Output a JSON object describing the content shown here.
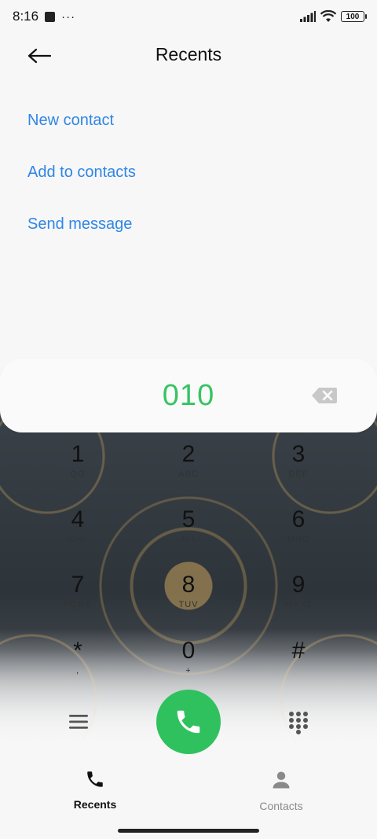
{
  "status_bar": {
    "time": "8:16",
    "more": "···",
    "battery": "100"
  },
  "header": {
    "title": "Recents",
    "back_icon": "arrow-left-icon"
  },
  "actions": [
    {
      "label": "New contact"
    },
    {
      "label": "Add to contacts"
    },
    {
      "label": "Send message"
    }
  ],
  "dialer": {
    "number": "010",
    "backspace_icon": "backspace-icon",
    "keys": [
      {
        "digit": "1",
        "letters": "QO"
      },
      {
        "digit": "2",
        "letters": "ABC"
      },
      {
        "digit": "3",
        "letters": "DEF"
      },
      {
        "digit": "4",
        "letters": "GHI"
      },
      {
        "digit": "5",
        "letters": "JKL"
      },
      {
        "digit": "6",
        "letters": "MNO"
      },
      {
        "digit": "7",
        "letters": "PQRS"
      },
      {
        "digit": "8",
        "letters": "TUV"
      },
      {
        "digit": "9",
        "letters": "WXYZ"
      },
      {
        "digit": "*",
        "letters": ","
      },
      {
        "digit": "0",
        "letters": "+"
      },
      {
        "digit": "#",
        "letters": ""
      }
    ],
    "accent_color": "#2fc15e"
  },
  "controls": {
    "menu_icon": "menu-icon",
    "call_icon": "phone-icon",
    "keypad_icon": "dialpad-icon"
  },
  "bottom_nav": {
    "recents_label": "Recents",
    "contacts_label": "Contacts"
  },
  "colors": {
    "link": "#2f86e6",
    "number": "#36c463"
  }
}
